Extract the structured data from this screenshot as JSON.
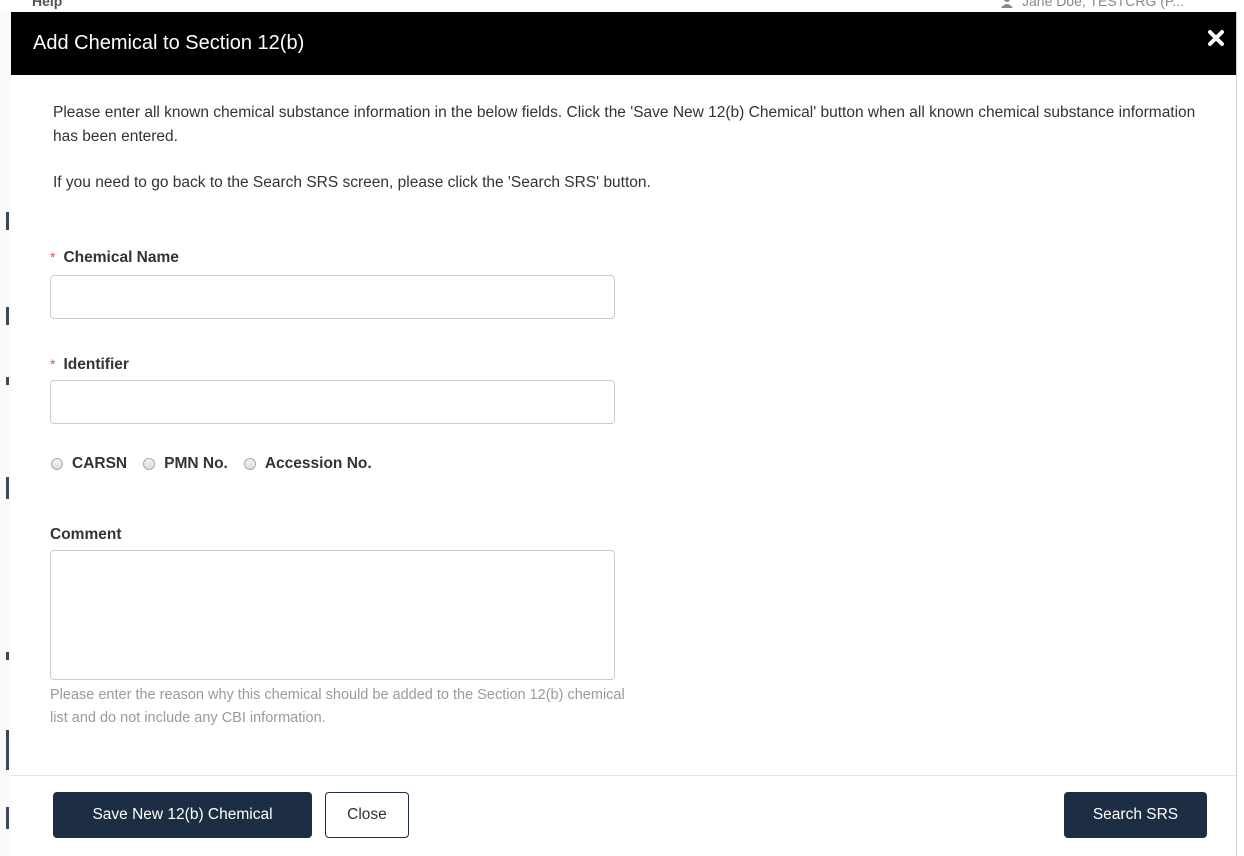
{
  "background": {
    "help_label": "Help",
    "user_label": "Jane Doe, TESTCRG (P..."
  },
  "modal": {
    "title": "Add Chemical to Section 12(b)",
    "close_icon": "close-icon",
    "intro_paragraph_1": "Please enter all known chemical substance information in the below fields. Click the 'Save New 12(b) Chemical' button when all known chemical substance information has been entered.",
    "intro_paragraph_2": "If you need to go back to the Search SRS screen, please click the 'Search SRS' button."
  },
  "form": {
    "required_marker": "*",
    "chemical_name": {
      "label": "Chemical Name",
      "value": "",
      "placeholder": ""
    },
    "identifier": {
      "label": "Identifier",
      "value": "",
      "placeholder": ""
    },
    "identifier_types": [
      {
        "label": "CARSN",
        "checked": false
      },
      {
        "label": "PMN No.",
        "checked": false
      },
      {
        "label": "Accession No.",
        "checked": false
      }
    ],
    "comment": {
      "label": "Comment",
      "value": "",
      "help_text": "Please enter the reason why this chemical should be added to the Section 12(b) chemical list and do not include any CBI information."
    }
  },
  "footer": {
    "save_label": "Save New 12(b) Chemical",
    "close_label": "Close",
    "search_label": "Search SRS"
  },
  "colors": {
    "header_bg": "#000000",
    "primary_button": "#1d2d44",
    "required": "#d9534f",
    "help_text": "#9a9a9a"
  }
}
